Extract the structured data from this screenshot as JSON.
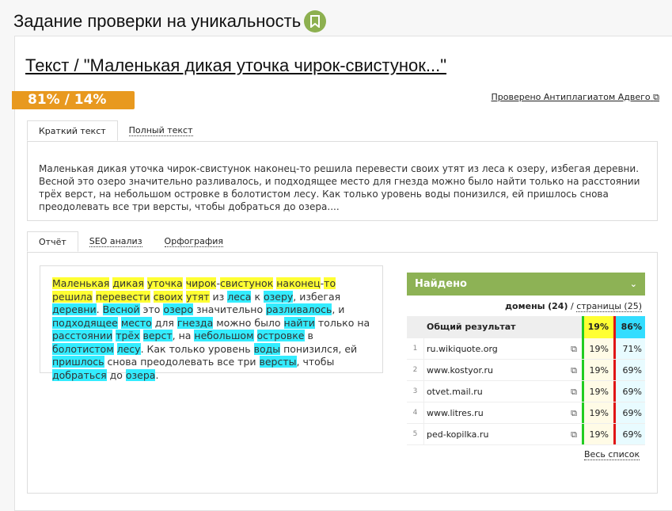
{
  "page": {
    "title": "Задание проверки на уникальность",
    "bookmark_icon": "bookmark-icon"
  },
  "heading": "Текст / \"Маленькая дикая уточка чирок-свистунок...\"",
  "score": "81% / 14%",
  "checked_link": "Проверено Антиплагиатом Адвего",
  "text_tabs": [
    {
      "label": "Краткий текст",
      "active": true
    },
    {
      "label": "Полный текст",
      "active": false
    }
  ],
  "summary": "Маленькая дикая уточка чирок-свистунок наконец-то решила перевести своих утят из леса к озеру, избегая деревни. Весной это озеро значительно разливалось, и подходящее место для гнезда можно было найти только на расстоянии трёх верст, на небольшом островке в болотистом лесу. Как только уровень воды понизился, ей пришлось снова преодолевать все три версты, чтобы добраться до озера....",
  "report_tabs": [
    {
      "label": "Отчёт",
      "active": true
    },
    {
      "label": "SEO анализ",
      "active": false
    },
    {
      "label": "Орфография",
      "active": false
    }
  ],
  "highlighted_text": [
    [
      "Маленькая",
      "y"
    ],
    [
      " ",
      ""
    ],
    [
      "дикая",
      "y"
    ],
    [
      " ",
      ""
    ],
    [
      "уточка",
      "y"
    ],
    [
      " ",
      ""
    ],
    [
      "чирок",
      "y"
    ],
    [
      "-",
      ""
    ],
    [
      "свистунок",
      "y"
    ],
    [
      " ",
      ""
    ],
    [
      "наконец",
      "y"
    ],
    [
      "-",
      ""
    ],
    [
      "то",
      "y"
    ],
    [
      " ",
      ""
    ],
    [
      "решила",
      "y"
    ],
    [
      " ",
      ""
    ],
    [
      "перевести",
      "y"
    ],
    [
      " ",
      ""
    ],
    [
      "своих",
      "y"
    ],
    [
      " ",
      ""
    ],
    [
      "утят",
      "y"
    ],
    [
      " из ",
      ""
    ],
    [
      "леса",
      "c"
    ],
    [
      " к ",
      ""
    ],
    [
      "озеру",
      "c"
    ],
    [
      ", избегая ",
      ""
    ],
    [
      "деревни",
      "c"
    ],
    [
      ". ",
      ""
    ],
    [
      "Весной",
      "c"
    ],
    [
      " это ",
      ""
    ],
    [
      "озеро",
      "c"
    ],
    [
      " значительно ",
      ""
    ],
    [
      "разливалось",
      "c"
    ],
    [
      ", и ",
      ""
    ],
    [
      "подходящее",
      "c"
    ],
    [
      " ",
      ""
    ],
    [
      "место",
      "c"
    ],
    [
      " для ",
      ""
    ],
    [
      "гнезда",
      "c"
    ],
    [
      " можно было ",
      ""
    ],
    [
      "найти",
      "c"
    ],
    [
      " только на ",
      ""
    ],
    [
      "расстоянии",
      "c"
    ],
    [
      " ",
      ""
    ],
    [
      "трёх",
      "c"
    ],
    [
      " ",
      ""
    ],
    [
      "верст",
      "c"
    ],
    [
      ", на ",
      ""
    ],
    [
      "небольшом",
      "c"
    ],
    [
      " ",
      ""
    ],
    [
      "островке",
      "c"
    ],
    [
      " в ",
      ""
    ],
    [
      "болотистом",
      "c"
    ],
    [
      " ",
      ""
    ],
    [
      "лесу",
      "c"
    ],
    [
      ". Как только уровень ",
      ""
    ],
    [
      "воды",
      "c"
    ],
    [
      " понизился, ей ",
      ""
    ],
    [
      "пришлось",
      "c"
    ],
    [
      " снова преодолевать все три ",
      ""
    ],
    [
      "версты",
      "c"
    ],
    [
      ", чтобы ",
      ""
    ],
    [
      "добраться",
      "c"
    ],
    [
      " до ",
      ""
    ],
    [
      "озера",
      "c"
    ],
    [
      ".",
      ""
    ]
  ],
  "found": {
    "title": "Найдено",
    "domains_label": "домены",
    "domains_count": "(24)",
    "separator": "/",
    "pages_label": "страницы (25)",
    "total": {
      "label": "Общий результат",
      "p1": "19%",
      "p2": "86%"
    },
    "rows": [
      {
        "n": "1",
        "domain": "ru.wikiquote.org",
        "p1": "19%",
        "p2": "71%"
      },
      {
        "n": "2",
        "domain": "www.kostyor.ru",
        "p1": "19%",
        "p2": "69%"
      },
      {
        "n": "3",
        "domain": "otvet.mail.ru",
        "p1": "19%",
        "p2": "69%"
      },
      {
        "n": "4",
        "domain": "www.litres.ru",
        "p1": "19%",
        "p2": "69%"
      },
      {
        "n": "5",
        "domain": "ped-kopilka.ru",
        "p1": "19%",
        "p2": "69%"
      }
    ],
    "all_link": "Весь список"
  },
  "colors": {
    "accent_green": "#8db255",
    "score_orange": "#e8991f",
    "yellow": "#ffff33",
    "cyan": "#33ecff"
  }
}
